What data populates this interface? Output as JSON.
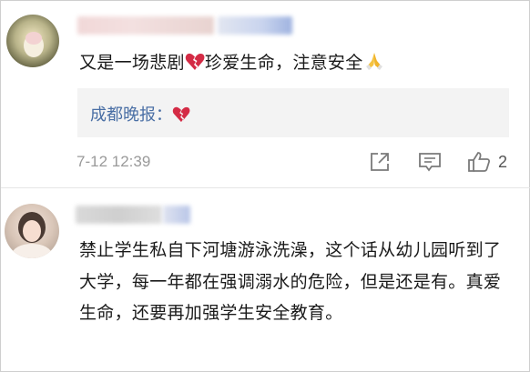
{
  "comments": [
    {
      "text_before": "又是一场悲剧",
      "text_after": "珍爱生命，注意安全",
      "emojis": [
        "broken-heart-icon",
        "praying-hands-icon"
      ],
      "reply": {
        "author": "成都晚报",
        "separator": "：",
        "emoji": "broken-heart-icon"
      },
      "timestamp": "7-12 12:39",
      "like_count": "2"
    },
    {
      "text": "禁止学生私自下河塘游泳洗澡，这个话从幼儿园听到了大学，每一年都在强调溺水的危险，但是还是有。真爱生命，还要再加强学生安全教育。"
    }
  ],
  "colors": {
    "link": "#4a6fa5",
    "meta": "#9a9a9a",
    "reply_bg": "#f3f3f3",
    "broken_heart": "#d42b45"
  }
}
